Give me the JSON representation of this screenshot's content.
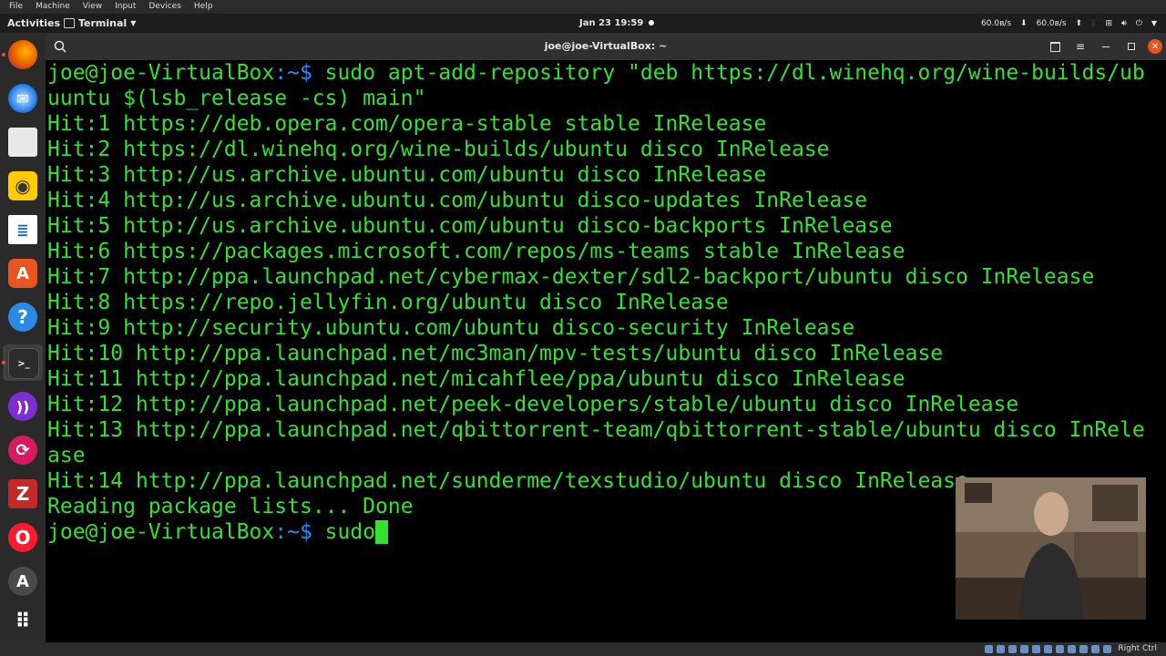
{
  "vbox_menu": [
    "File",
    "Machine",
    "View",
    "Input",
    "Devices",
    "Help"
  ],
  "topbar": {
    "activities": "Activities",
    "app_name": "Terminal",
    "clock": "Jan 23  19:59",
    "net_up": "60.0ʙ/s",
    "net_down": "60.0ʙ/s"
  },
  "dock": {
    "icons": [
      "firefox-icon",
      "thunderbird-icon",
      "files-icon",
      "rhythmbox-icon",
      "libreoffice-writer-icon",
      "software-center-icon",
      "help-icon",
      "terminal-icon",
      "podcast-icon",
      "sync-icon",
      "filezilla-icon",
      "opera-icon",
      "updater-icon",
      "show-apps-icon"
    ]
  },
  "terminal": {
    "title": "joe@joe-VirtualBox: ~",
    "prompt_user": "joe@joe-VirtualBox",
    "prompt_sep": ":",
    "prompt_path": "~",
    "prompt_sym": "$",
    "lines": [
      "uuntu $(lsb_release -cs) main\"",
      "Hit:1 https://deb.opera.com/opera-stable stable InRelease",
      "Hit:2 https://dl.winehq.org/wine-builds/ubuntu disco InRelease",
      "Hit:3 http://us.archive.ubuntu.com/ubuntu disco InRelease",
      "Hit:4 http://us.archive.ubuntu.com/ubuntu disco-updates InRelease",
      "Hit:5 http://us.archive.ubuntu.com/ubuntu disco-backports InRelease",
      "Hit:6 https://packages.microsoft.com/repos/ms-teams stable InRelease",
      "Hit:7 http://ppa.launchpad.net/cybermax-dexter/sdl2-backport/ubuntu disco InRelease",
      "Hit:8 https://repo.jellyfin.org/ubuntu disco InRelease",
      "Hit:9 http://security.ubuntu.com/ubuntu disco-security InRelease",
      "Hit:10 http://ppa.launchpad.net/mc3man/mpv-tests/ubuntu disco InRelease",
      "Hit:11 http://ppa.launchpad.net/micahflee/ppa/ubuntu disco InRelease",
      "Hit:12 http://ppa.launchpad.net/peek-developers/stable/ubuntu disco InRelease",
      "Hit:13 http://ppa.launchpad.net/qbittorrent-team/qbittorrent-stable/ubuntu disco InRele",
      "ase",
      "Hit:14 http://ppa.launchpad.net/sunderme/texstudio/ubuntu disco InRelease",
      "Reading package lists... Done"
    ],
    "first_command": " sudo apt-add-repository \"deb https://dl.winehq.org/wine-builds/ub",
    "current_command": " sudo"
  },
  "statusbar": {
    "host_key": "Right Ctrl"
  }
}
